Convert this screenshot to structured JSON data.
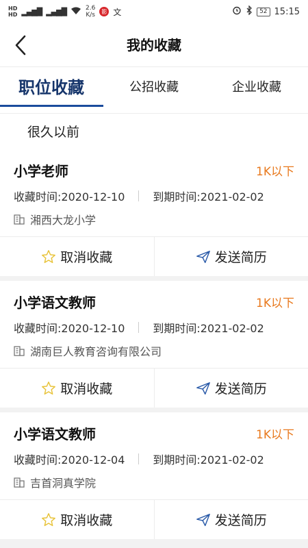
{
  "status_bar": {
    "left_top_label": "HD",
    "left_bottom_label": "HD",
    "net_speed_value": "2.6",
    "net_speed_unit": "K/s",
    "app_icon_text": "影",
    "text_icon": "文",
    "battery": "52",
    "time": "15:15"
  },
  "navbar": {
    "title": "我的收藏"
  },
  "tabs": [
    {
      "label": "职位收藏",
      "active": true
    },
    {
      "label": "公招收藏",
      "active": false
    },
    {
      "label": "企业收藏",
      "active": false
    }
  ],
  "time_group": "很久以前",
  "jobs": [
    {
      "title": "小学老师",
      "salary": "1K以下",
      "collect_time": "收藏时间:2020-12-10",
      "expire_time": "到期时间:2021-02-02",
      "company": "湘西大龙小学",
      "cancel_label": "取消收藏",
      "send_label": "发送简历"
    },
    {
      "title": "小学语文教师",
      "salary": "1K以下",
      "collect_time": "收藏时间:2020-12-10",
      "expire_time": "到期时间:2021-02-02",
      "company": "湖南巨人教育咨询有限公司",
      "cancel_label": "取消收藏",
      "send_label": "发送简历"
    },
    {
      "title": "小学语文教师",
      "salary": "1K以下",
      "collect_time": "收藏时间:2020-12-04",
      "expire_time": "到期时间:2021-02-02",
      "company": "吉首洞真学院",
      "cancel_label": "取消收藏",
      "send_label": "发送简历"
    }
  ],
  "colors": {
    "accent": "#1a4b9c",
    "salary": "#e8791e",
    "star": "#e8c33a",
    "send_icon": "#2a5aa8"
  }
}
